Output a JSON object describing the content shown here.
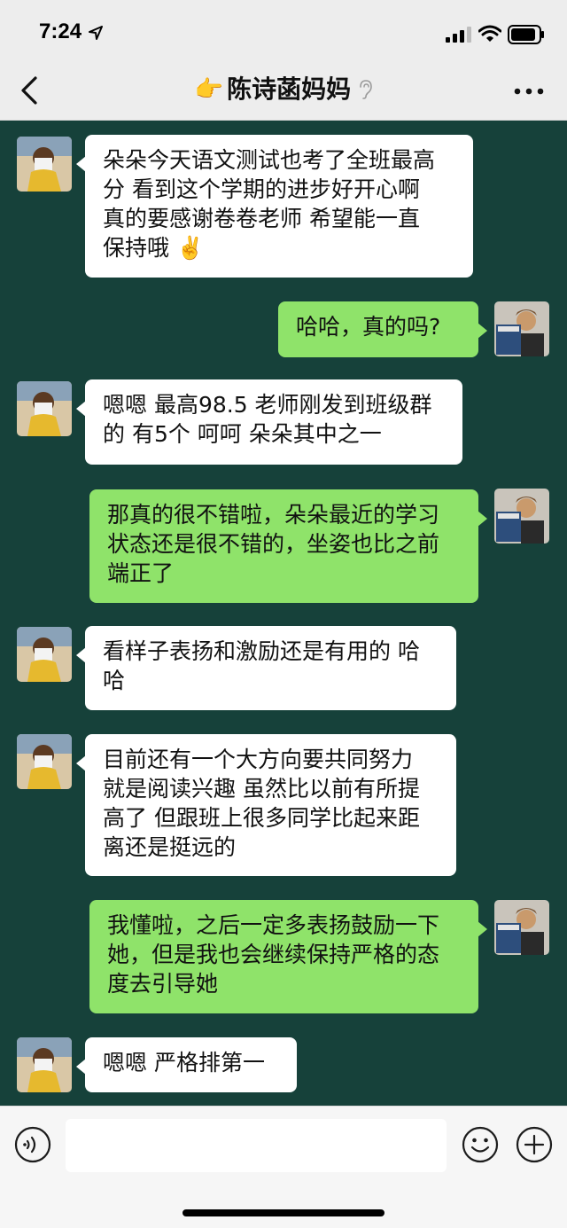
{
  "status_bar": {
    "time": "7:24"
  },
  "header": {
    "title_emoji": "👉",
    "title": "陈诗菡妈妈"
  },
  "messages": [
    {
      "side": "in",
      "text": "朵朵今天语文测试也考了全班最高\n分 看到这个学期的进步好开心啊\n真的要感谢卷卷老师 希望能一直\n保持哦 ✌️"
    },
    {
      "side": "out",
      "text": "哈哈，真的吗?"
    },
    {
      "side": "in",
      "text": "嗯嗯 最高98.5 老师刚发到班级群\n的 有5个 呵呵 朵朵其中之一"
    },
    {
      "side": "out",
      "text": "那真的很不错啦，朵朵最近的学习\n状态还是很不错的，坐姿也比之前\n端正了"
    },
    {
      "side": "in",
      "text": "看样子表扬和激励还是有用的 哈\n哈"
    },
    {
      "side": "in",
      "text": "目前还有一个大方向要共同努力\n就是阅读兴趣 虽然比以前有所提\n高了 但跟班上很多同学比起来距\n离还是挺远的"
    },
    {
      "side": "out",
      "text": "我懂啦，之后一定多表扬鼓励一下\n她，但是我也会继续保持严格的态\n度去引导她"
    },
    {
      "side": "in",
      "text": "嗯嗯 严格排第一"
    }
  ],
  "avatars": {
    "contact_icon": "child-photo-avatar-icon",
    "self_icon": "magazine-boy-avatar-icon"
  },
  "input": {
    "value": "",
    "placeholder": ""
  },
  "icons": {
    "back": "chevron-left-icon",
    "more": "more-dots-icon",
    "voice": "voice-icon",
    "emoji": "emoji-icon",
    "plus": "plus-icon"
  },
  "colors": {
    "chat_background": "#16413a",
    "outgoing_bubble": "#8fe36a",
    "incoming_bubble": "#ffffff",
    "header_background": "#ededed"
  }
}
